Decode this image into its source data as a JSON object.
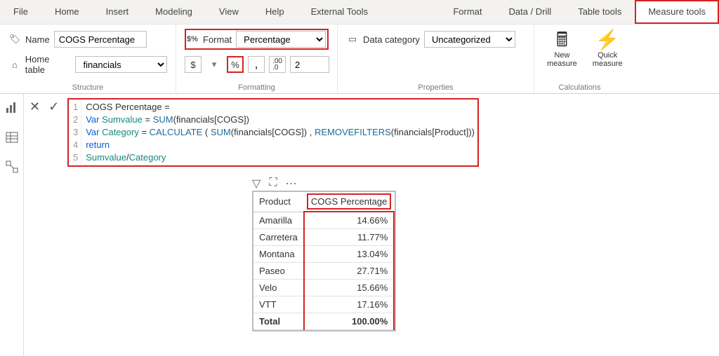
{
  "tabs": {
    "file": "File",
    "home": "Home",
    "insert": "Insert",
    "modeling": "Modeling",
    "view": "View",
    "help": "Help",
    "external": "External Tools",
    "format": "Format",
    "datadrill": "Data / Drill",
    "tabletools": "Table tools",
    "measuretools": "Measure tools"
  },
  "structure": {
    "name_label": "Name",
    "name_value": "COGS Percentage",
    "hometable_label": "Home table",
    "hometable_value": "financials",
    "group": "Structure"
  },
  "formatting": {
    "format_label": "Format",
    "format_value": "Percentage",
    "currency": "$",
    "percent": "%",
    "comma": ",",
    "decimals_value": "2",
    "group": "Formatting"
  },
  "properties": {
    "datacat_label": "Data category",
    "datacat_value": "Uncategorized",
    "group": "Properties"
  },
  "calculations": {
    "new_measure": "New\nmeasure",
    "quick_measure": "Quick\nmeasure",
    "group": "Calculations"
  },
  "formula": {
    "l1": "COGS Percentage =",
    "l2a": "Var",
    "l2b": "Sumvalue",
    "l2c": " = ",
    "l2d": "SUM",
    "l2e": "(financials[COGS])",
    "l3a": "Var",
    "l3b": "Category",
    "l3c": " = ",
    "l3d": "CALCULATE",
    "l3e": " ( ",
    "l3f": "SUM",
    "l3g": "(financials[COGS]) , ",
    "l3h": "REMOVEFILTERS",
    "l3i": "(financials[Product]))",
    "l4": "return",
    "l5a": "Sumvalue",
    "l5b": "/",
    "l5c": "Category"
  },
  "table": {
    "h1": "Product",
    "h2": "COGS Percentage",
    "rows": [
      {
        "p": "Amarilla",
        "v": "14.66%"
      },
      {
        "p": "Carretera",
        "v": "11.77%"
      },
      {
        "p": "Montana",
        "v": "13.04%"
      },
      {
        "p": "Paseo",
        "v": "27.71%"
      },
      {
        "p": "Velo",
        "v": "15.66%"
      },
      {
        "p": "VTT",
        "v": "17.16%"
      }
    ],
    "total_label": "Total",
    "total_value": "100.00%"
  },
  "chart_data": {
    "type": "table",
    "columns": [
      "Product",
      "COGS Percentage"
    ],
    "rows": [
      [
        "Amarilla",
        14.66
      ],
      [
        "Carretera",
        11.77
      ],
      [
        "Montana",
        13.04
      ],
      [
        "Paseo",
        27.71
      ],
      [
        "Velo",
        15.66
      ],
      [
        "VTT",
        17.16
      ]
    ],
    "total": 100.0,
    "unit": "%"
  }
}
